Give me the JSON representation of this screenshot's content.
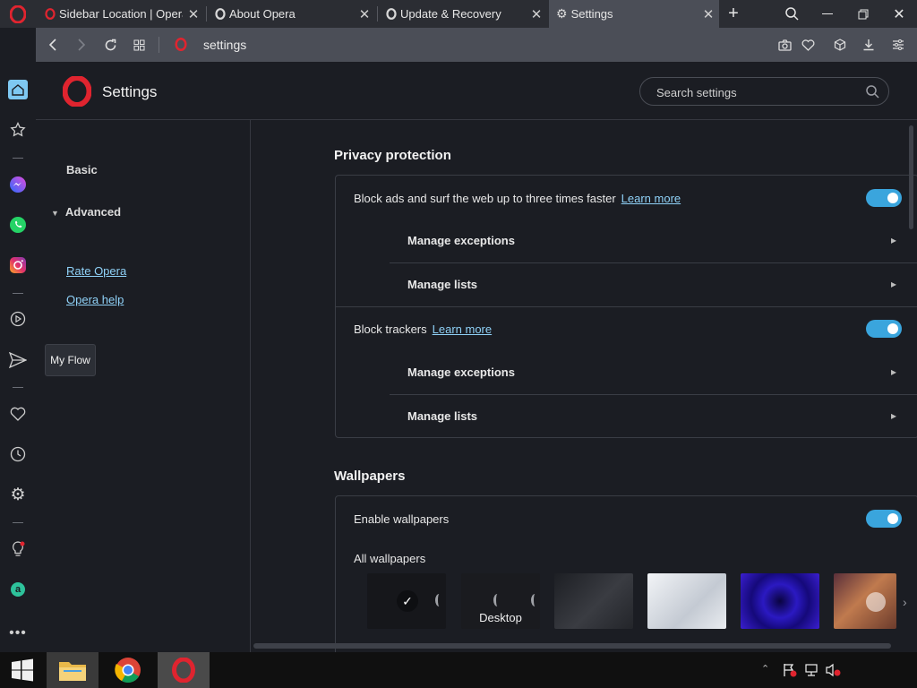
{
  "browser": {
    "tabs": [
      {
        "title": "Sidebar Location | Opera",
        "icon": "opera-icon"
      },
      {
        "title": "About Opera",
        "icon": "opera-icon"
      },
      {
        "title": "Update & Recovery",
        "icon": "opera-icon"
      },
      {
        "title": "Settings",
        "icon": "gear-icon",
        "active": true
      }
    ],
    "url": "settings"
  },
  "sidebar": {
    "tooltip": "My Flow",
    "items": [
      "home-icon",
      "star-icon",
      "messenger-icon",
      "whatsapp-icon",
      "instagram-icon",
      "player-icon",
      "my-flow-icon",
      "heart-icon",
      "history-icon",
      "gear-icon",
      "bulb-icon",
      "aria-icon",
      "more-icon"
    ]
  },
  "header": {
    "title": "Settings",
    "search_placeholder": "Search settings"
  },
  "nav": {
    "basic": "Basic",
    "advanced": "Advanced",
    "rate": "Rate Opera",
    "help": "Opera help"
  },
  "privacy": {
    "title": "Privacy protection",
    "block_ads": "Block ads and surf the web up to three times faster",
    "learn_more": "Learn more",
    "manage_exceptions": "Manage exceptions",
    "manage_lists": "Manage lists",
    "block_trackers": "Block trackers",
    "block_ads_on": true,
    "block_trackers_on": true
  },
  "wallpapers": {
    "title": "Wallpapers",
    "enable": "Enable wallpapers",
    "enabled": true,
    "all": "All wallpapers",
    "items": [
      {
        "name": "",
        "selected": true,
        "color": "#16171b"
      },
      {
        "name": "Desktop",
        "selected": false,
        "color": "#1a1b1f"
      },
      {
        "name": "",
        "selected": false,
        "color": "#2a2c31"
      },
      {
        "name": "",
        "selected": false,
        "color": "#d6dbe2"
      },
      {
        "name": "",
        "selected": false,
        "color": "#2a1aa8"
      },
      {
        "name": "",
        "selected": false,
        "color": "#a05a3c"
      }
    ]
  },
  "colors": {
    "accent": "#3aa5dd",
    "link": "#8fd1f7",
    "opera_red": "#e0242f"
  }
}
